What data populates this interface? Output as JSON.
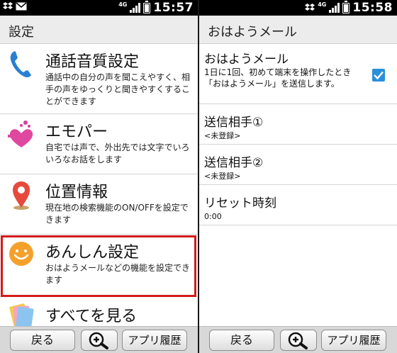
{
  "left": {
    "status": {
      "time": "15:57",
      "network": "4G"
    },
    "title": "設定",
    "items": [
      {
        "icon": "phone-icon",
        "title": "通話音質設定",
        "desc": "通話中の自分の声を聞こえやすく、相手の声をゆっくりと聞きやすくすることができます"
      },
      {
        "icon": "heart-icon",
        "title": "エモパー",
        "desc": "自宅では声で、外出先では文字でいろいろなお話をします"
      },
      {
        "icon": "location-pin-icon",
        "title": "位置情報",
        "desc": "現在地の検索機能のON/OFFを設定できます"
      },
      {
        "icon": "smiley-icon",
        "title": "あんしん設定",
        "desc": "おはようメールなどの機能を設定できます"
      },
      {
        "icon": "cards-icon",
        "title": "すべてを見る",
        "desc": ""
      }
    ],
    "bottom": {
      "back": "戻る",
      "history": "アプリ履歴"
    }
  },
  "right": {
    "status": {
      "time": "15:58",
      "network": "4G"
    },
    "title": "おはようメール",
    "rows": [
      {
        "title": "おはようメール",
        "sub": "1日に1回、初めて端末を操作したとき「おはようメール」を送信します。",
        "checked": true
      },
      {
        "title": "送信相手①",
        "sub": "<未登録>"
      },
      {
        "title": "送信相手②",
        "sub": "<未登録>"
      },
      {
        "title": "リセット時刻",
        "sub": "0:00"
      }
    ],
    "bottom": {
      "back": "戻る",
      "history": "アプリ履歴"
    }
  },
  "colors": {
    "highlight": "#d41a1a",
    "checkbox": "#2a8fd8"
  }
}
